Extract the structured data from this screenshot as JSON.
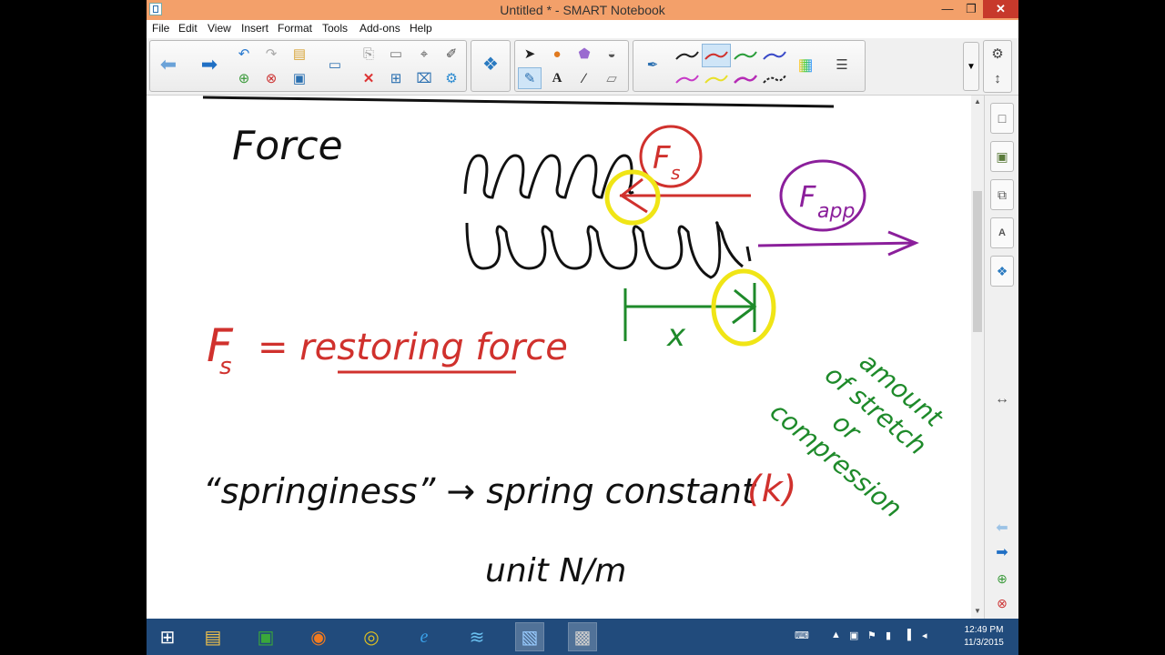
{
  "window": {
    "title": "Untitled * - SMART Notebook",
    "minimize": "—",
    "restore": "❐",
    "close": "✕"
  },
  "menu": [
    "File",
    "Edit",
    "View",
    "Insert",
    "Format",
    "Tools",
    "Add-ons",
    "Help"
  ],
  "toolbar": {
    "icons": [
      "back-arrow-icon",
      "forward-arrow-icon",
      "undo-icon",
      "redo-icon",
      "open-folder-icon",
      "add-page-icon",
      "delete-page-icon",
      "save-icon",
      "screen-icon",
      "paste-icon",
      "delete-icon",
      "screen-shade-icon",
      "table-icon",
      "measurement-icon",
      "clear-icon",
      "magic-pen-icon",
      "addons-icon",
      "select-icon",
      "shapes-icon",
      "regular-polygon-icon",
      "fill-icon",
      "pens-icon",
      "text-icon",
      "line-icon",
      "eraser-icon",
      "pen-icon",
      "color-palette-icon",
      "properties-icon"
    ],
    "pen_colors": [
      "#222222",
      "#d0312d",
      "#2a9d3a",
      "#3b4bc8",
      "#c73bc7",
      "#e8e02a",
      "#b52bb5",
      "#222222"
    ]
  },
  "sidebar": [
    "page-sorter-icon",
    "gallery-icon",
    "attachments-icon",
    "properties-icon",
    "addons-icon"
  ],
  "page_nav": {
    "move_icon": "↔",
    "prev_icon": "prev-page-icon",
    "next_icon": "next-page-icon"
  },
  "canvas": {
    "heading": "Force",
    "fs_label": "F",
    "fs_sub": "s",
    "fapp_label": "F",
    "fapp_sub": "app",
    "x_label": "x",
    "restoring": "= restoring force",
    "springiness": "“springiness” → spring constant",
    "k_label": "(k)",
    "unit": "unit   N/m",
    "side_note": [
      "amount",
      "of stretch",
      "or",
      "compression"
    ]
  },
  "taskbar": {
    "time": "12:49 PM",
    "date": "11/3/2015",
    "apps": [
      "windows-start-icon",
      "file-explorer-icon",
      "store-icon",
      "firefox-icon",
      "chrome-icon",
      "internet-explorer-icon",
      "windows-live-icon",
      "smart-notebook-icon",
      "recorder-icon"
    ]
  }
}
